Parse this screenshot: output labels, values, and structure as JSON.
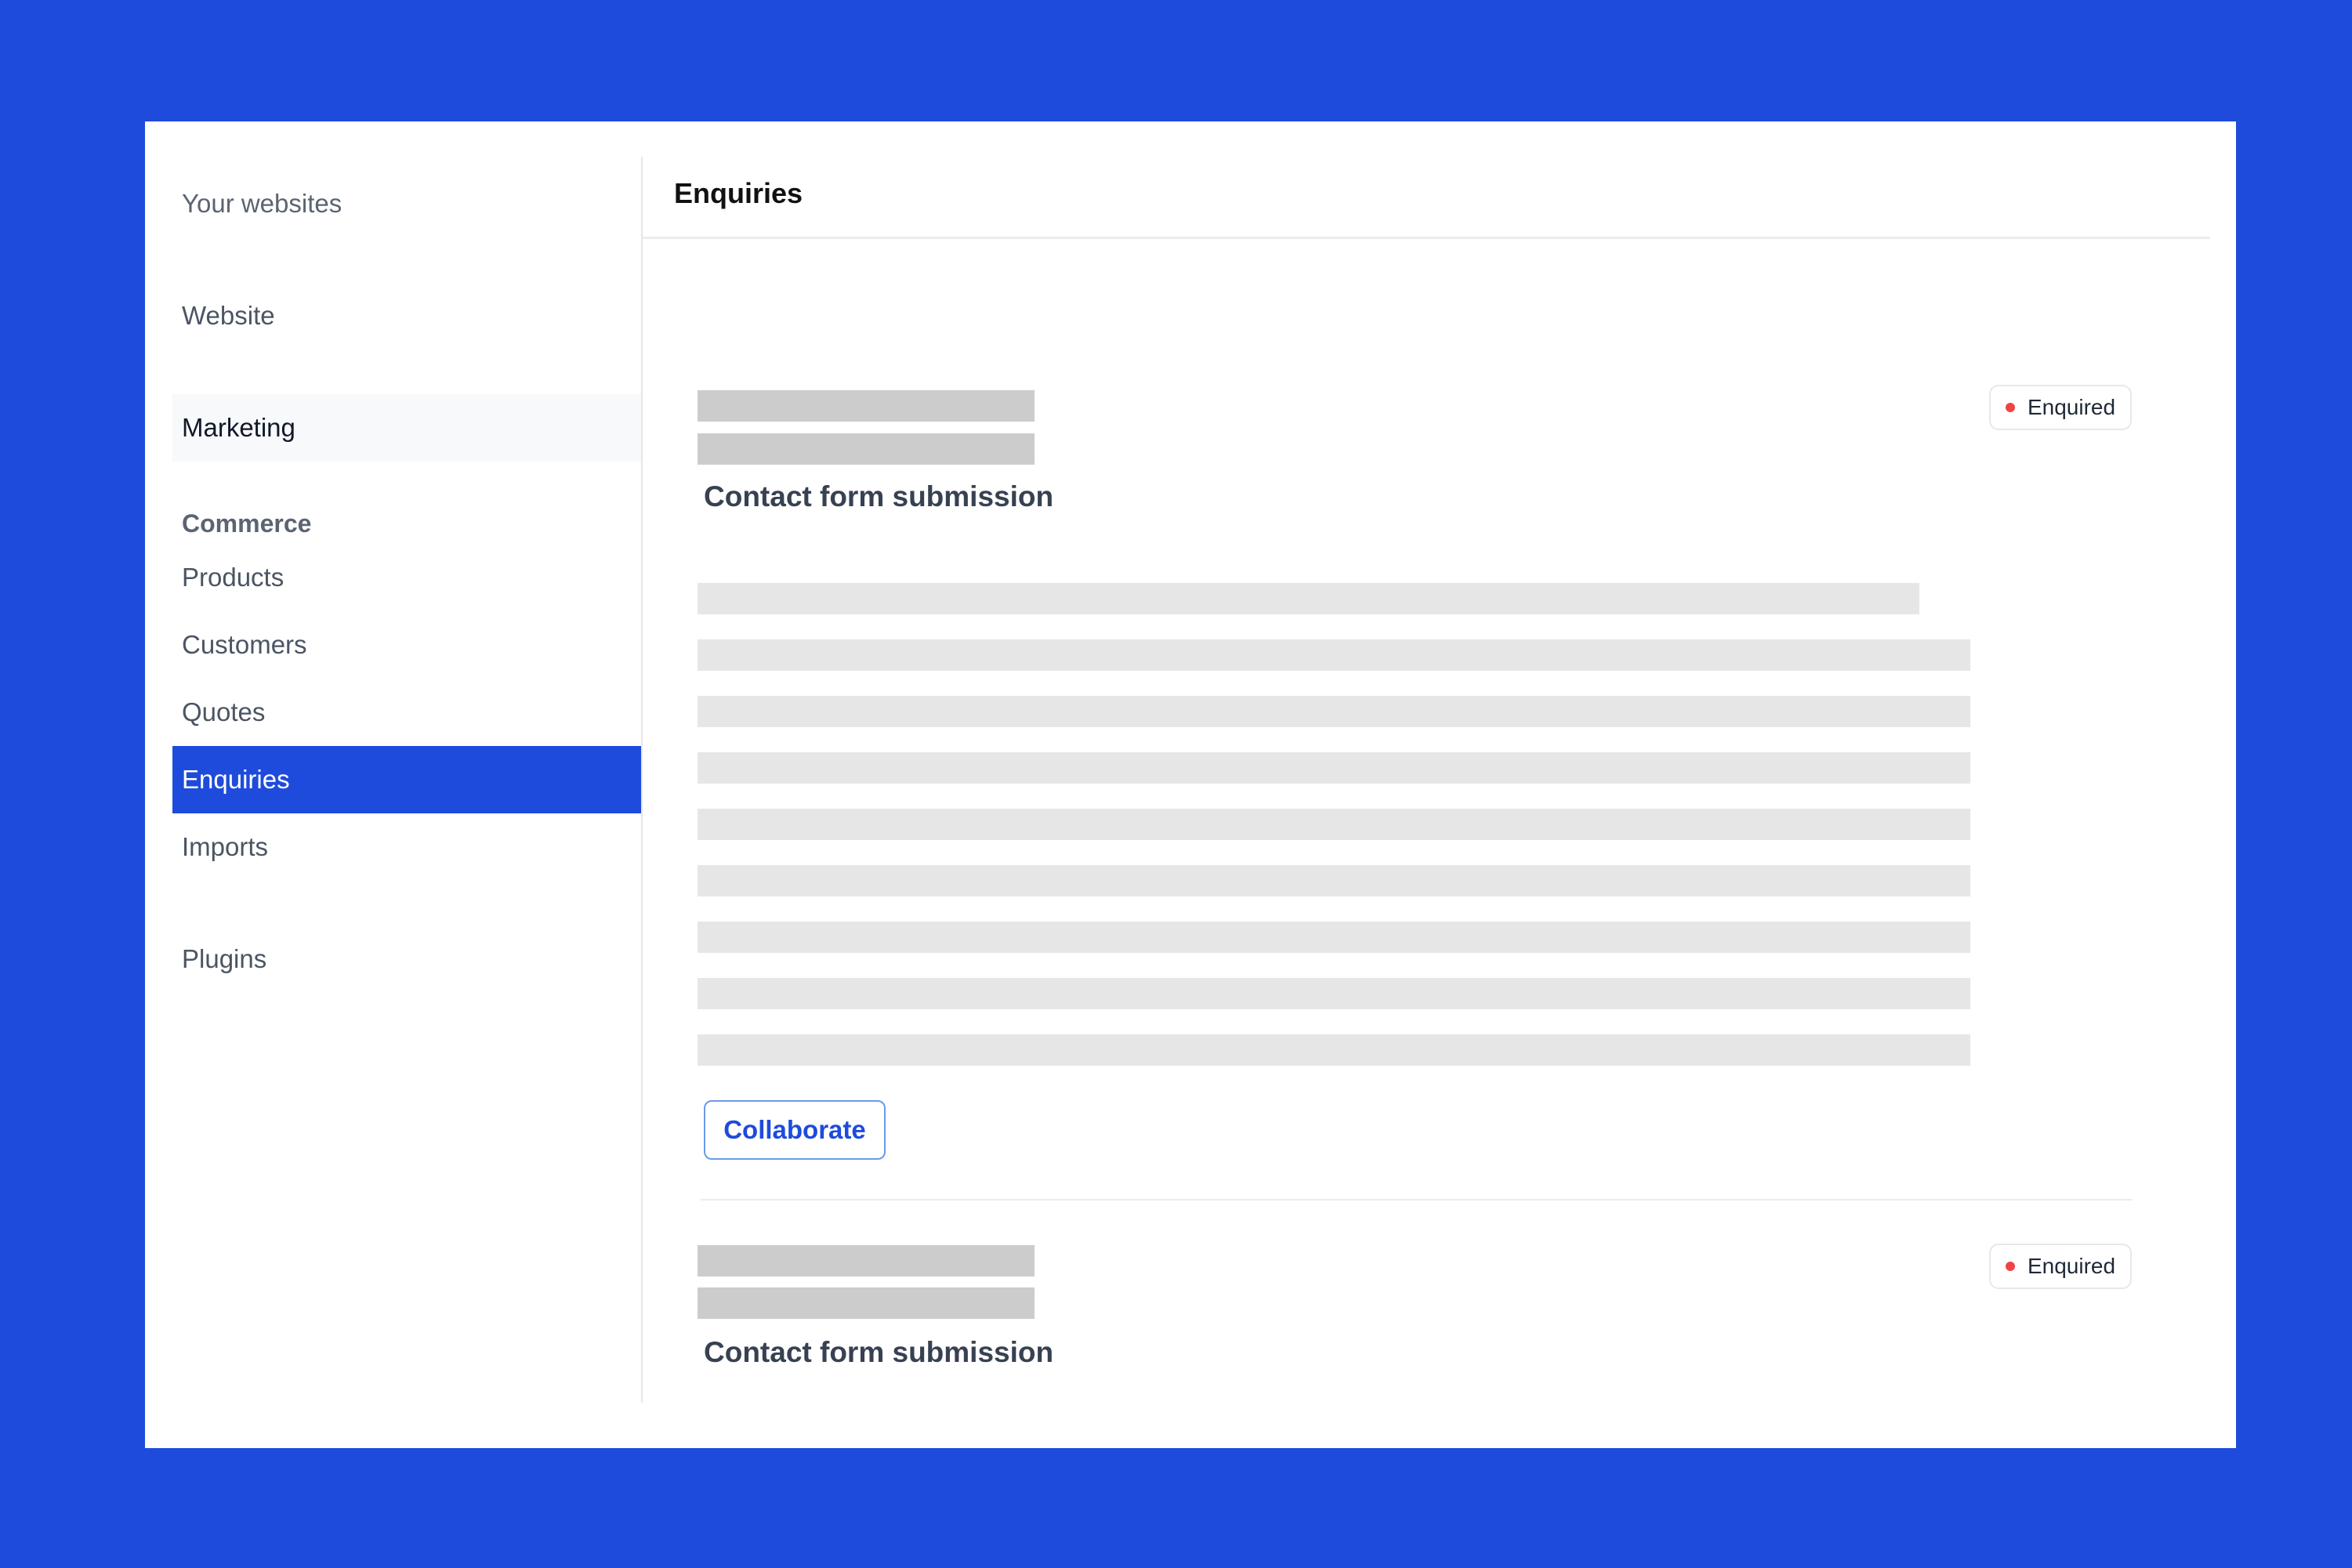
{
  "colors": {
    "background": "#1e4bdc",
    "accent": "#1e4bdc",
    "status_enquired": "#ef4444",
    "skeleton_dark": "#cccccc",
    "skeleton_light": "#e6e6e6"
  },
  "sidebar": {
    "items": [
      {
        "label": "Your websites"
      },
      {
        "label": "Website"
      },
      {
        "label": "Marketing"
      },
      {
        "heading": "Commerce"
      },
      {
        "label": "Products"
      },
      {
        "label": "Customers"
      },
      {
        "label": "Quotes"
      },
      {
        "label": "Enquiries",
        "active": true
      },
      {
        "label": "Imports"
      },
      {
        "label": "Plugins"
      }
    ]
  },
  "header": {
    "title": "Enquiries"
  },
  "enquiries": [
    {
      "title": "Contact form submission",
      "status": "Enquired",
      "body_lines": 9,
      "action_label": "Collaborate"
    },
    {
      "title": "Contact form submission",
      "status": "Enquired"
    }
  ]
}
